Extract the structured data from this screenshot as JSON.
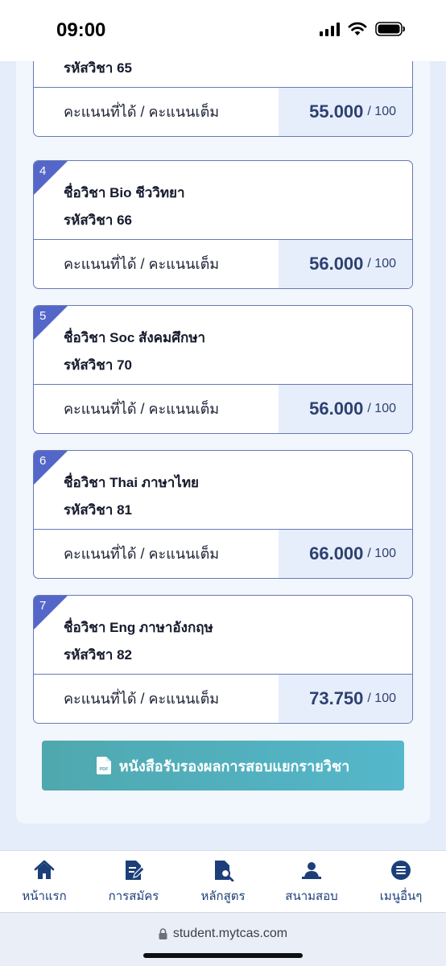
{
  "status": {
    "time": "09:00"
  },
  "first_card": {
    "code_label": "รหัสวิชา 65",
    "score_label": "คะแนนที่ได้ / คะแนนเต็ม",
    "score": "55.000",
    "max": "/ 100"
  },
  "cards": [
    {
      "index": "4",
      "name": "ชื่อวิชา Bio ชีววิทยา",
      "code": "รหัสวิชา 66",
      "score_label": "คะแนนที่ได้ / คะแนนเต็ม",
      "score": "56.000",
      "max": "/ 100"
    },
    {
      "index": "5",
      "name": "ชื่อวิชา Soc สังคมศึกษา",
      "code": "รหัสวิชา 70",
      "score_label": "คะแนนที่ได้ / คะแนนเต็ม",
      "score": "56.000",
      "max": "/ 100"
    },
    {
      "index": "6",
      "name": "ชื่อวิชา Thai ภาษาไทย",
      "code": "รหัสวิชา 81",
      "score_label": "คะแนนที่ได้ / คะแนนเต็ม",
      "score": "66.000",
      "max": "/ 100"
    },
    {
      "index": "7",
      "name": "ชื่อวิชา Eng ภาษาอังกฤษ",
      "code": "รหัสวิชา 82",
      "score_label": "คะแนนที่ได้ / คะแนนเต็ม",
      "score": "73.750",
      "max": "/ 100"
    }
  ],
  "pdf_button": {
    "icon": "pdf-icon",
    "label": "หนังสือรับรองผลการสอบแยกรายวิชา"
  },
  "nav": [
    {
      "icon": "home-icon",
      "label": "หน้าแรก"
    },
    {
      "icon": "application-form-icon",
      "label": "การสมัคร"
    },
    {
      "icon": "course-search-icon",
      "label": "หลักสูตร"
    },
    {
      "icon": "exam-venue-icon",
      "label": "สนามสอบ"
    },
    {
      "icon": "menu-icon",
      "label": "เมนูอื่นๆ"
    }
  ],
  "browser": {
    "url": "student.mytcas.com"
  },
  "colors": {
    "accent": "#5467c9",
    "score_text": "#2d4170",
    "nav": "#1c3f79",
    "button": "#4ea8ae"
  }
}
